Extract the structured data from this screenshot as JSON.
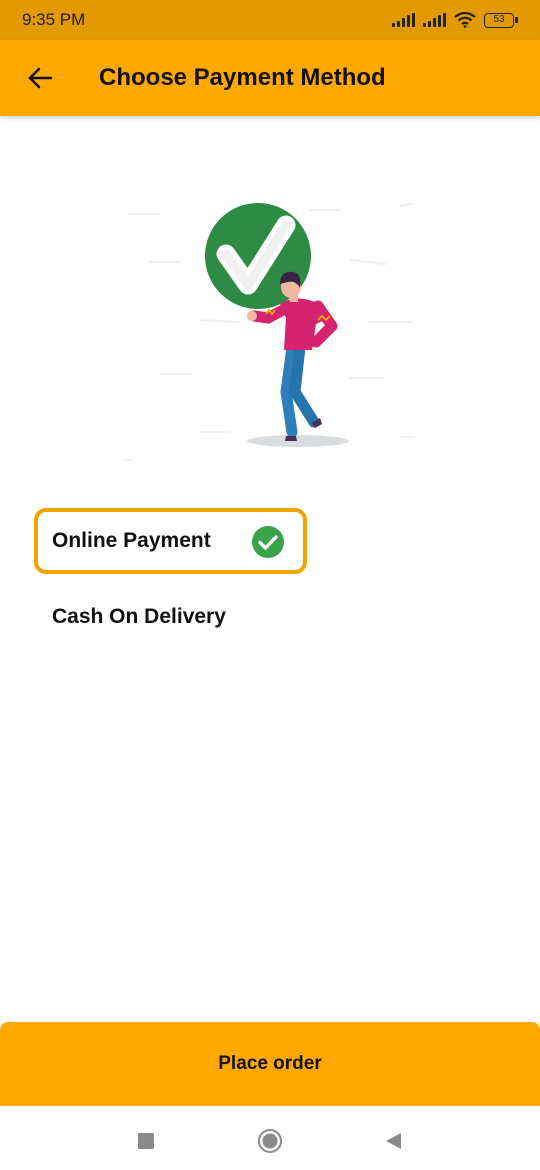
{
  "status_bar": {
    "time": "9:35 PM",
    "battery": "53"
  },
  "app_bar": {
    "title": "Choose Payment Method",
    "back_icon": "arrow-left-icon"
  },
  "payment_options": [
    {
      "label": "Online Payment",
      "selected": true,
      "icon": "check-circle-icon"
    },
    {
      "label": "Cash On Delivery",
      "selected": false
    }
  ],
  "place_order_label": "Place order",
  "colors": {
    "status_bar": "#e29a00",
    "app_bar": "#ffa800",
    "selected_border": "#f0a400",
    "check_green": "#3aa34a",
    "illustration_green": "#2e8b45",
    "shirt_pink": "#d6236f"
  }
}
